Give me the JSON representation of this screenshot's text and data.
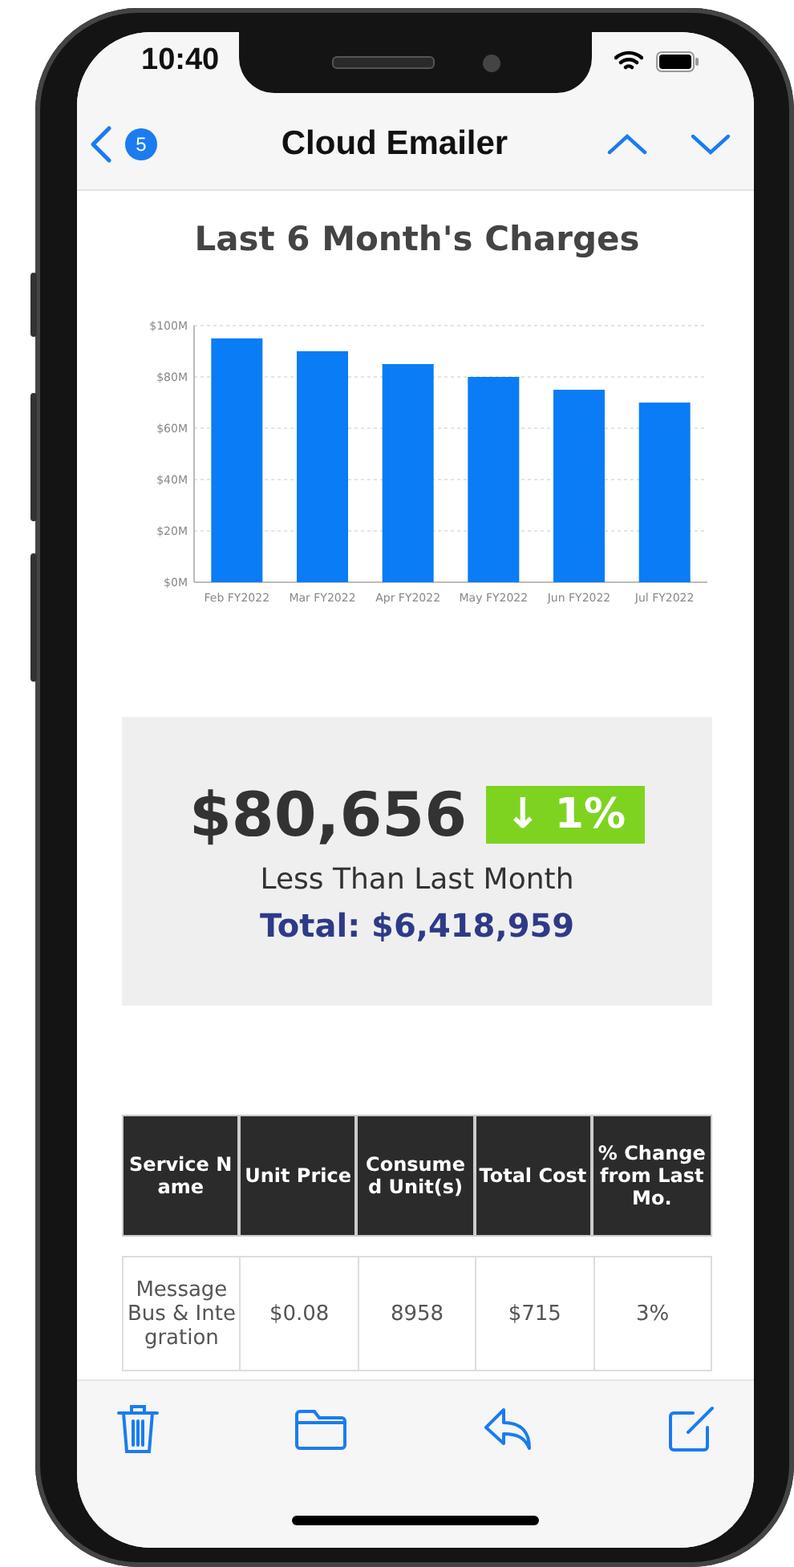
{
  "status_bar": {
    "time": "10:40"
  },
  "nav_bar": {
    "badge": "5",
    "title": "Cloud Emailer"
  },
  "email": {
    "heading": "Last 6 Month's Charges",
    "chart_data": {
      "type": "bar",
      "categories": [
        "Feb FY2022",
        "Mar FY2022",
        "Apr FY2022",
        "May FY2022",
        "Jun FY2022",
        "Jul FY2022"
      ],
      "values": [
        95,
        90,
        85,
        80,
        75,
        70
      ],
      "ylim": [
        0,
        100
      ],
      "grid": true,
      "yticks": [
        {
          "value": 0,
          "label": "$0M"
        },
        {
          "value": 20,
          "label": "$20M"
        },
        {
          "value": 40,
          "label": "$40M"
        },
        {
          "value": 60,
          "label": "$60M"
        },
        {
          "value": 80,
          "label": "$80M"
        },
        {
          "value": 100,
          "label": "$100M"
        }
      ]
    },
    "summary": {
      "amount": "$80,656",
      "change": "↓ 1%",
      "caption": "Less Than Last Month",
      "total": "Total: $6,418,959"
    },
    "table": {
      "columns": [
        "Service Name",
        "Unit Price",
        "Consumed Unit(s)",
        "Total Cost",
        "% Change from Last Mo."
      ],
      "rows": [
        [
          "Message Bus & Integration",
          "$0.08",
          "8958",
          "$715",
          "3%"
        ]
      ]
    }
  }
}
